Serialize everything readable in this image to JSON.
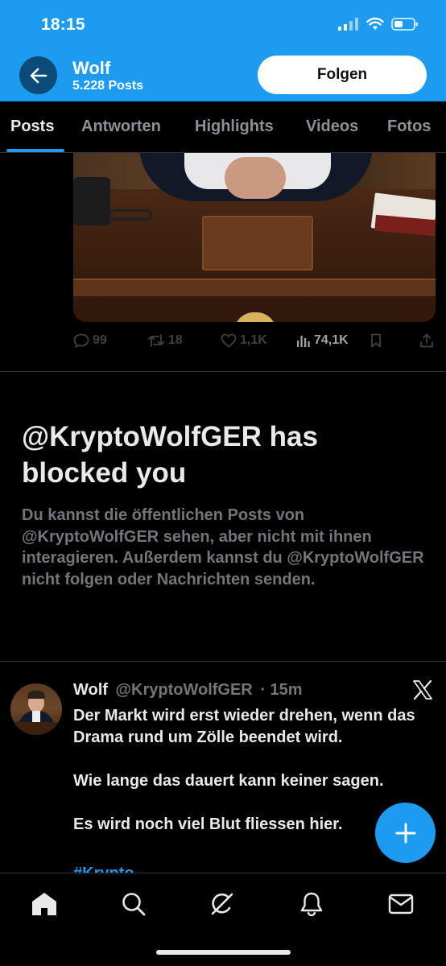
{
  "status_bar": {
    "time": "18:15"
  },
  "header": {
    "title": "Wolf",
    "subtitle": "5.228 Posts",
    "follow_label": "Folgen"
  },
  "tabs": [
    {
      "label": "Posts",
      "active": true
    },
    {
      "label": "Antworten",
      "active": false
    },
    {
      "label": "Highlights",
      "active": false
    },
    {
      "label": "Videos",
      "active": false
    },
    {
      "label": "Fotos",
      "active": false
    }
  ],
  "previous_post": {
    "replies": "99",
    "reposts": "18",
    "likes": "1,1K",
    "views": "74,1K"
  },
  "blocked": {
    "title": "@KryptoWolfGER has blocked you",
    "body": "Du kannst die öffentlichen Posts von @KryptoWolfGER sehen, aber nicht mit ihnen interagieren. Außerdem kannst du @KryptoWolfGER nicht folgen oder Nachrichten senden."
  },
  "tweet": {
    "author": "Wolf",
    "handle": "@KryptoWolfGER",
    "time": "· 15m",
    "paragraphs": [
      "Der Markt wird erst wieder drehen, wenn das Drama rund um Zölle beendet wird.",
      "Wie lange das dauert kann keiner sagen.",
      "Es wird noch viel Blut fliessen hier."
    ],
    "hashtag": "#Krypto"
  },
  "colors": {
    "accent": "#1d9bf0",
    "background": "#000000",
    "text_primary": "#e7e9ea",
    "text_secondary": "#71767b",
    "divider": "#2f3336"
  },
  "icons": {
    "back": "arrow-left-icon",
    "reply": "speech-bubble-icon",
    "repost": "repost-icon",
    "like": "heart-icon",
    "views": "bar-chart-icon",
    "bookmark": "bookmark-icon",
    "share": "share-icon",
    "compose": "plus-icon",
    "nav": [
      "home-icon",
      "search-icon",
      "grok-icon",
      "bell-icon",
      "mail-icon"
    ]
  }
}
